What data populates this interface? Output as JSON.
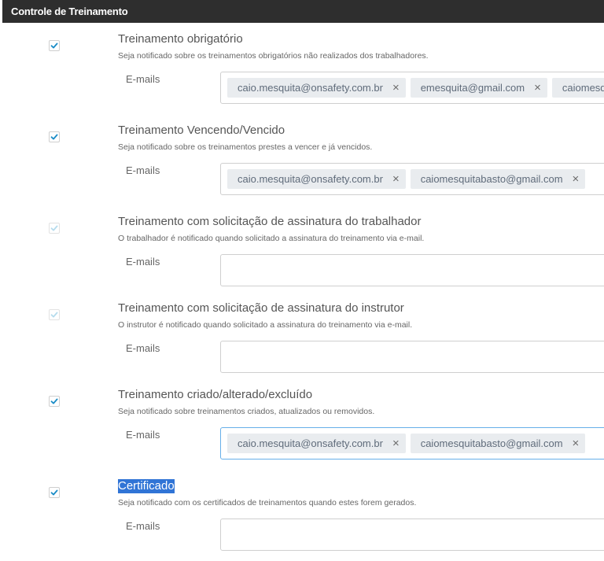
{
  "header": {
    "title": "Controle de Treinamento"
  },
  "sections": [
    {
      "title": "Treinamento obrigatório",
      "description": "Seja notificado sobre os treinamentos obrigatórios não realizados dos trabalhadores.",
      "checked": true,
      "disabled": false,
      "emails_label": "E-mails",
      "emails": [
        "caio.mesquita@onsafety.com.br",
        "emesquita@gmail.com",
        "caiomesquitabasto@gmail.com"
      ]
    },
    {
      "title": "Treinamento Vencendo/Vencido",
      "description": "Seja notificado sobre os treinamentos prestes a vencer e já vencidos.",
      "checked": true,
      "disabled": false,
      "emails_label": "E-mails",
      "emails": [
        "caio.mesquita@onsafety.com.br",
        "caiomesquitabasto@gmail.com"
      ]
    },
    {
      "title": "Treinamento com solicitação de assinatura do trabalhador",
      "description": "O trabalhador é notificado quando solicitado a assinatura do treinamento via e-mail.",
      "checked": true,
      "disabled": true,
      "emails_label": "E-mails",
      "emails": []
    },
    {
      "title": "Treinamento com solicitação de assinatura do instrutor",
      "description": "O instrutor é notificado quando solicitado a assinatura do treinamento via e-mail.",
      "checked": true,
      "disabled": true,
      "emails_label": "E-mails",
      "emails": []
    },
    {
      "title": "Treinamento criado/alterado/excluído",
      "description": "Seja notificado sobre treinamentos criados, atualizados ou removidos.",
      "checked": true,
      "disabled": false,
      "emails_label": "E-mails",
      "emails": [
        "caio.mesquita@onsafety.com.br",
        "caiomesquitabasto@gmail.com"
      ],
      "focused": true
    },
    {
      "title": "Certificado",
      "description": "Seja notificado com os certificados de treinamentos quando estes forem gerados.",
      "checked": true,
      "disabled": false,
      "emails_label": "E-mails",
      "emails": [],
      "title_selected": true
    }
  ],
  "icons": {
    "checkmark": "check-icon",
    "remove": "close-icon",
    "remove_glyph": "×"
  },
  "colors": {
    "header_bg": "#2e2e2e",
    "check": "#1a8cc7",
    "check_disabled": "#b6dced",
    "tag_bg": "#e9ecef",
    "selection": "#3074d6"
  }
}
